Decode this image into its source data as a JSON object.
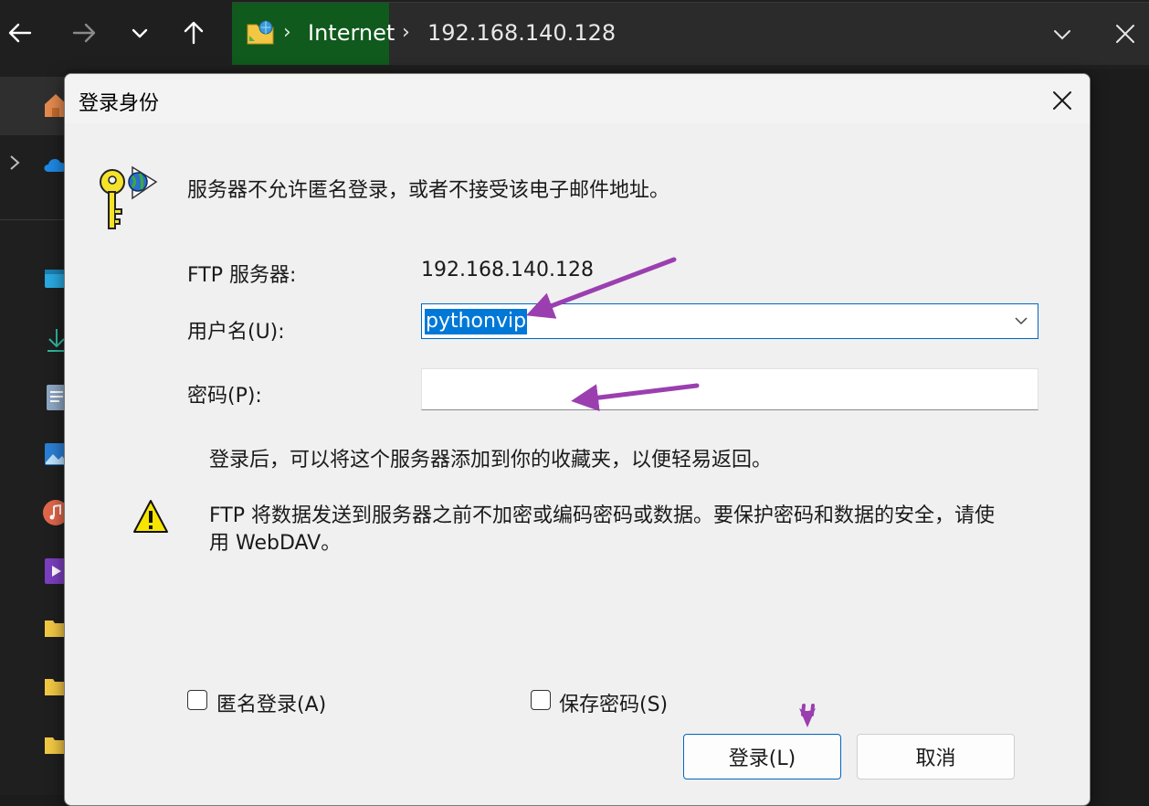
{
  "explorer": {
    "address_segments": [
      "Internet",
      "192.168.140.128"
    ],
    "nav_icons": [
      "back-arrow-icon",
      "forward-arrow-icon",
      "chevron-down-icon",
      "up-arrow-icon"
    ]
  },
  "dialog": {
    "title": "登录身份",
    "message": "服务器不允许匿名登录，或者不接受该电子邮件地址。",
    "ftp_server_label": "FTP 服务器:",
    "ftp_server_value": "192.168.140.128",
    "username_label": "用户名(U):",
    "username_value": "pythonvip",
    "password_label": "密码(P):",
    "password_value": "",
    "favorites_note": "登录后，可以将这个服务器添加到你的收藏夹，以便轻易返回。",
    "warning_line1": "FTP 将数据发送到服务器之前不加密或编码密码或数据。要保护密码和数据的安全，请使",
    "warning_line2": "用 WebDAV。",
    "anonymous_label": "匿名登录(A)",
    "anonymous_checked": false,
    "save_password_label": "保存密码(S)",
    "save_password_checked": false,
    "login_button": "登录(L)",
    "cancel_button": "取消"
  },
  "colors": {
    "accent": "#0078d7",
    "annotation_arrow": "#9b3fb0",
    "address_highlight": "#0f5a1c"
  }
}
